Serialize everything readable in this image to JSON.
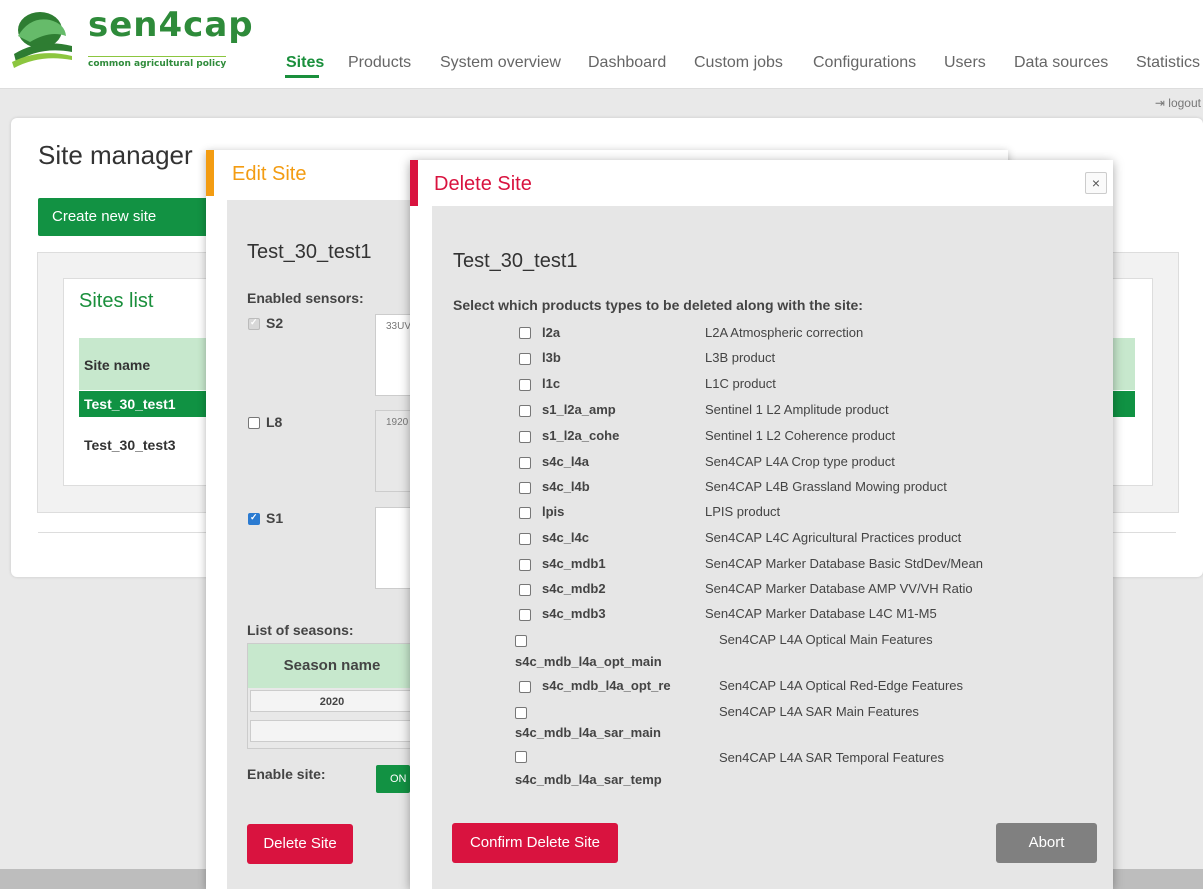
{
  "app": {
    "logo_word": "sen4cap",
    "logo_sub": "common agricultural policy"
  },
  "nav": {
    "items": [
      {
        "label": "Sites",
        "active": true
      },
      {
        "label": "Products",
        "active": false
      },
      {
        "label": "System overview",
        "active": false
      },
      {
        "label": "Dashboard",
        "active": false
      },
      {
        "label": "Custom jobs",
        "active": false
      },
      {
        "label": "Configurations",
        "active": false
      },
      {
        "label": "Users",
        "active": false
      },
      {
        "label": "Data sources",
        "active": false
      },
      {
        "label": "Statistics",
        "active": false
      }
    ],
    "logout": "logout"
  },
  "site_manager": {
    "title": "Site manager",
    "create_button": "Create new site",
    "sites_list_title": "Sites list",
    "column_site_name": "Site name",
    "rows": [
      "Test_30_test1",
      "Test_30_test3"
    ]
  },
  "edit_site": {
    "title": "Edit Site",
    "site_name": "Test_30_test1",
    "enabled_sensors_label": "Enabled sensors:",
    "sensors": [
      {
        "name": "S2",
        "state": "disabled-checked",
        "value": "33UV"
      },
      {
        "name": "L8",
        "state": "unchecked",
        "value": "1920"
      },
      {
        "name": "S1",
        "state": "checked",
        "value": ""
      }
    ],
    "seasons_label": "List of seasons:",
    "season_column": "Season name",
    "seasons": [
      "2020"
    ],
    "enable_site_label": "Enable site:",
    "toggle_on": "ON",
    "delete_button": "Delete Site"
  },
  "delete_site": {
    "title": "Delete Site",
    "close": "×",
    "site_name": "Test_30_test1",
    "instruction": "Select which products types to be deleted along with the site:",
    "products": [
      {
        "type": "l2a",
        "desc": "L2A Atmospheric correction"
      },
      {
        "type": "l3b",
        "desc": "L3B product"
      },
      {
        "type": "l1c",
        "desc": "L1C product"
      },
      {
        "type": "s1_l2a_amp",
        "desc": "Sentinel 1 L2 Amplitude product"
      },
      {
        "type": "s1_l2a_cohe",
        "desc": "Sentinel 1 L2 Coherence product"
      },
      {
        "type": "s4c_l4a",
        "desc": "Sen4CAP L4A Crop type product"
      },
      {
        "type": "s4c_l4b",
        "desc": "Sen4CAP L4B Grassland Mowing product"
      },
      {
        "type": "lpis",
        "desc": "LPIS product"
      },
      {
        "type": "s4c_l4c",
        "desc": "Sen4CAP L4C Agricultural Practices product"
      },
      {
        "type": "s4c_mdb1",
        "desc": "Sen4CAP Marker Database Basic StdDev/Mean"
      },
      {
        "type": "s4c_mdb2",
        "desc": "Sen4CAP Marker Database AMP VV/VH Ratio"
      },
      {
        "type": "s4c_mdb3",
        "desc": "Sen4CAP Marker Database L4C M1-M5"
      },
      {
        "type": "s4c_mdb_l4a_opt_main",
        "desc": "Sen4CAP L4A Optical Main Features"
      },
      {
        "type": "s4c_mdb_l4a_opt_re",
        "desc": "Sen4CAP L4A Optical Red-Edge Features"
      },
      {
        "type": "s4c_mdb_l4a_sar_main",
        "desc": "Sen4CAP L4A SAR Main Features"
      },
      {
        "type": "s4c_mdb_l4a_sar_temp",
        "desc": "Sen4CAP L4A SAR Temporal Features"
      }
    ],
    "confirm_button": "Confirm Delete Site",
    "abort_button": "Abort"
  }
}
